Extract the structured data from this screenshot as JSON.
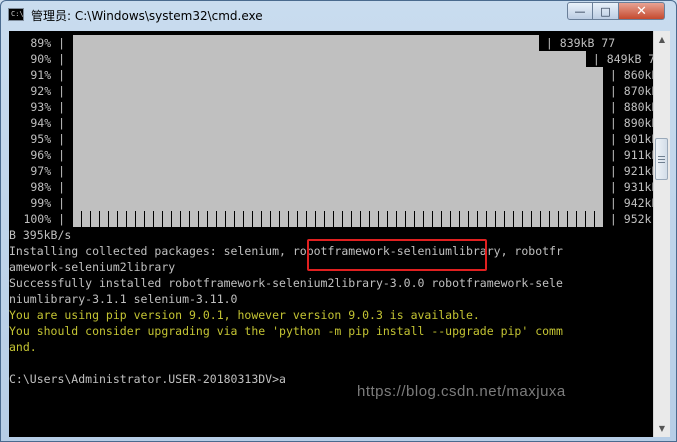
{
  "window": {
    "title": "管理员: C:\\Windows\\system32\\cmd.exe",
    "icon": "cmd-icon",
    "min_glyph": "—",
    "max_glyph": "□",
    "close_glyph": "✕"
  },
  "progress_rows": [
    {
      "percent": "89%",
      "tail": " | 839kB 77",
      "fill": 0.89
    },
    {
      "percent": "90%",
      "tail": " | 849kB 78",
      "fill": 0.9
    },
    {
      "percent": "91%",
      "tail": " | 860kB 7",
      "fill": 0.91
    },
    {
      "percent": "92%",
      "tail": " | 870kB 7",
      "fill": 0.92
    },
    {
      "percent": "93%",
      "tail": " | 880kB 7",
      "fill": 0.93
    },
    {
      "percent": "94%",
      "tail": " | 890kB",
      "fill": 0.94
    },
    {
      "percent": "95%",
      "tail": " | 901kB",
      "fill": 0.95
    },
    {
      "percent": "96%",
      "tail": " | 911kB",
      "fill": 0.96
    },
    {
      "percent": "97%",
      "tail": " | 921kB",
      "fill": 0.97
    },
    {
      "percent": "98%",
      "tail": " | 931kB",
      "fill": 0.98
    },
    {
      "percent": "99%",
      "tail": " | 942kB",
      "fill": 0.99
    },
    {
      "percent": "100%",
      "tail": " | 952k",
      "fill": 1.0
    }
  ],
  "lines": {
    "speed": "B 395kB/s",
    "installing": "Installing collected packages: selenium, robotframework-seleniumlibrary, robotfr",
    "installing_cont": "amework-selenium2library",
    "success": "Successfully installed robotframework-selenium2library-3.0.0 robotframework-sele",
    "success_cont": "niumlibrary-3.1.1 selenium-3.11.0",
    "warn1": "You are using pip version 9.0.1, however version 9.0.3 is available.",
    "warn2": "You should consider upgrading via the 'python -m pip install --upgrade pip' comm",
    "warn3": "and.",
    "blank": "",
    "prompt": "C:\\Users\\Administrator.USER-20180313DV>a"
  },
  "colors": {
    "console_bg": "#000000",
    "console_text": "#c0c0c0",
    "warning_text": "#c4c433",
    "highlight": "#e02020"
  },
  "watermark": "https://blog.csdn.net/maxjuxa"
}
